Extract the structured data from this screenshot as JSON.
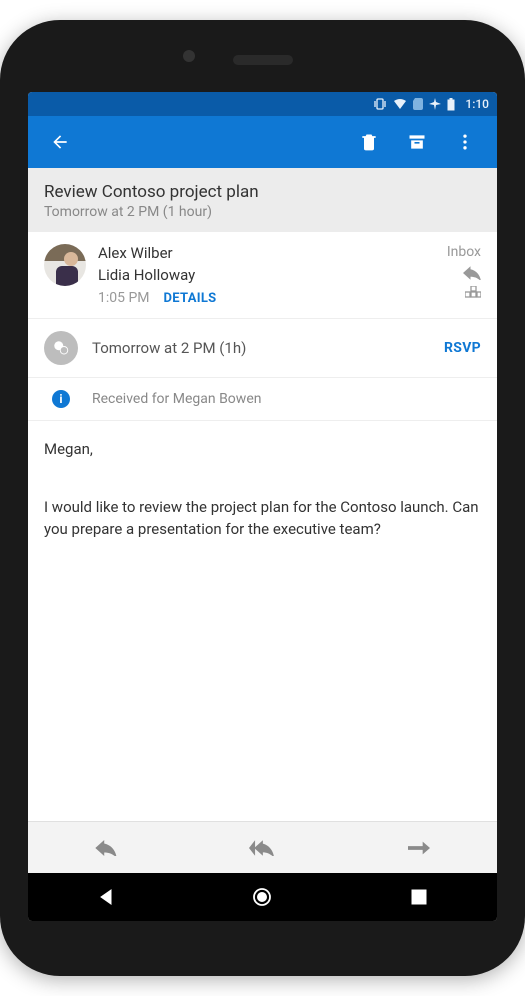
{
  "status": {
    "time": "1:10"
  },
  "subject": {
    "title": "Review Contoso project plan",
    "subtitle": "Tomorrow at 2 PM (1 hour)"
  },
  "sender": {
    "name": "Alex Wilber",
    "recipient": "Lidia Holloway",
    "time": "1:05 PM",
    "details_label": "DETAILS",
    "folder": "Inbox"
  },
  "event": {
    "text": "Tomorrow at 2 PM (1h)",
    "rsvp_label": "RSVP"
  },
  "info": {
    "text": "Received for Megan Bowen"
  },
  "body": {
    "salutation": "Megan,",
    "paragraph": "I would like to review the project plan for the Contoso launch. Can you prepare a presentation for the executive team?"
  }
}
